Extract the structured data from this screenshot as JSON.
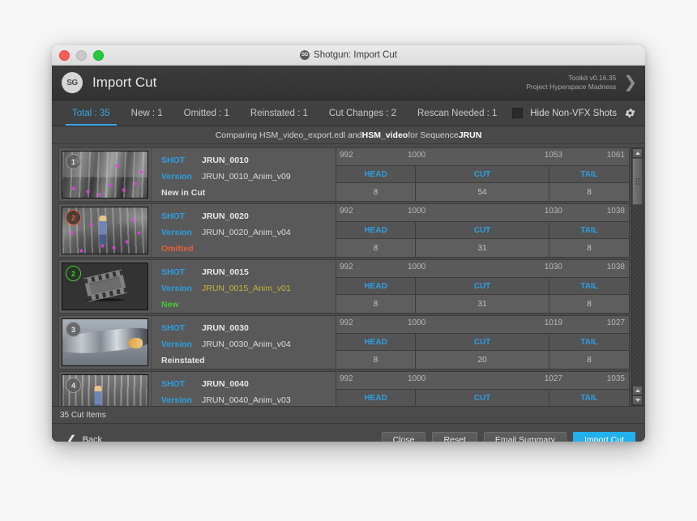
{
  "window": {
    "os_title": "Shotgun: Import Cut",
    "logo_text": "SG",
    "app_title": "Import Cut",
    "toolkit_version": "Toolkit v0.16.35",
    "project": "Project Hyperspace Madness",
    "chevron_icon": "chevron-right-icon"
  },
  "tabs": [
    {
      "label": "Total : 35",
      "active": true
    },
    {
      "label": "New : 1",
      "active": false
    },
    {
      "label": "Omitted : 1",
      "active": false
    },
    {
      "label": "Reinstated : 1",
      "active": false
    },
    {
      "label": "Cut Changes : 2",
      "active": false
    },
    {
      "label": "Rescan Needed : 1",
      "active": false
    }
  ],
  "toolbar": {
    "hide_non_vfx_label": "Hide Non-VFX Shots",
    "hide_non_vfx_checked": false,
    "gear_icon": "gear-icon"
  },
  "comparing": {
    "prefix": "Comparing HSM_video_export.edl and ",
    "bold1": "HSM_video",
    "middle": " for Sequence ",
    "bold2": "JRUN"
  },
  "columns": {
    "head": "HEAD",
    "cut": "CUT",
    "tail": "TAIL",
    "shot_key": "SHOT",
    "version_key": "Version"
  },
  "rows": [
    {
      "badge": "1",
      "badge_style": "neutral",
      "thumb": "forest",
      "shot": "JRUN_0010",
      "version": "JRUN_0010_Anim_v09",
      "version_style": "plain",
      "status": "New in Cut",
      "status_style": "neutral",
      "tc": {
        "a": "992",
        "b": "1000",
        "c": "1053",
        "d": "1061"
      },
      "values": {
        "head": "8",
        "cut": "54",
        "tail": "8"
      }
    },
    {
      "badge": "2",
      "badge_style": "omitted",
      "thumb": "char",
      "shot": "JRUN_0020",
      "version": "JRUN_0020_Anim_v04",
      "version_style": "plain",
      "status": "Omitted",
      "status_style": "omitted",
      "tc": {
        "a": "992",
        "b": "1000",
        "c": "1030",
        "d": "1038"
      },
      "values": {
        "head": "8",
        "cut": "31",
        "tail": "8"
      }
    },
    {
      "badge": "2",
      "badge_style": "new",
      "thumb": "placeholder",
      "shot": "JRUN_0015",
      "version": "JRUN_0015_Anim_v01",
      "version_style": "yellow",
      "status": "New",
      "status_style": "new",
      "tc": {
        "a": "992",
        "b": "1000",
        "c": "1030",
        "d": "1038"
      },
      "values": {
        "head": "8",
        "cut": "31",
        "tail": "8"
      }
    },
    {
      "badge": "3",
      "badge_style": "neutral",
      "thumb": "mech",
      "shot": "JRUN_0030",
      "version": "JRUN_0030_Anim_v04",
      "version_style": "plain",
      "status": "Reinstated",
      "status_style": "reinstated",
      "tc": {
        "a": "992",
        "b": "1000",
        "c": "1019",
        "d": "1027"
      },
      "values": {
        "head": "8",
        "cut": "20",
        "tail": "8"
      }
    },
    {
      "badge": "4",
      "badge_style": "neutral",
      "thumb": "crowd",
      "shot": "JRUN_0040",
      "version": "JRUN_0040_Anim_v03",
      "version_style": "plain",
      "status": "",
      "status_style": "neutral",
      "tc": {
        "a": "992",
        "b": "1000",
        "c": "1027",
        "d": "1035"
      },
      "values": {
        "head": "",
        "cut": "",
        "tail": ""
      }
    }
  ],
  "status_bar": {
    "text": "35 Cut Items"
  },
  "footer": {
    "back_label": "Back",
    "back_icon": "chevron-left-icon",
    "buttons": [
      {
        "label": "Close",
        "primary": false
      },
      {
        "label": "Reset",
        "primary": false
      },
      {
        "label": "Email Summary",
        "primary": false
      },
      {
        "label": "Import Cut",
        "primary": true
      }
    ]
  },
  "colors": {
    "accent_blue": "#2e9fe0",
    "primary_button": "#23b0ef",
    "omitted": "#e0613a",
    "new": "#4ec63a",
    "yellow": "#c8b33a"
  }
}
